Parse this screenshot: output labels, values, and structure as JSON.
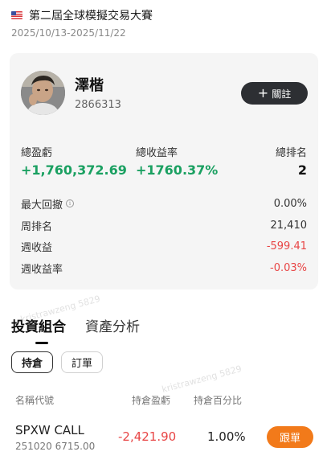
{
  "header": {
    "contest_name": "第二屆全球模擬交易大賽",
    "date_range": "2025/10/13-2025/11/22"
  },
  "profile": {
    "username": "澤楷",
    "user_id": "2866313",
    "follow_label": "關註"
  },
  "stats": {
    "total_pnl_label": "總盈虧",
    "total_pnl_value": "+1,760,372.69",
    "total_return_label": "總收益率",
    "total_return_value": "+1760.37%",
    "total_rank_label": "總排名",
    "total_rank_value": "2"
  },
  "metrics": {
    "max_drawdown_label": "最大回撤",
    "max_drawdown_value": "0.00%",
    "weekly_rank_label": "周排名",
    "weekly_rank_value": "21,410",
    "weekly_pnl_label": "週收益",
    "weekly_pnl_value": "-599.41",
    "weekly_return_label": "週收益率",
    "weekly_return_value": "-0.03%"
  },
  "tabs": [
    "投資組合",
    "資產分析"
  ],
  "subtabs": [
    "持倉",
    "訂單"
  ],
  "columns": [
    "名稱代號",
    "持倉盈虧",
    "持倉百分比"
  ],
  "positions": [
    {
      "name": "SPXW CALL",
      "detail": "251020 6715.00",
      "pnl": "-2,421.90",
      "percent": "1.00%",
      "action": "跟單"
    }
  ],
  "watermark": "kristrawzeng 5829",
  "colors": {
    "positive": "#1aa061",
    "negative": "#e84545",
    "accent": "#f27a1a",
    "dark_button": "#2d2f33"
  }
}
